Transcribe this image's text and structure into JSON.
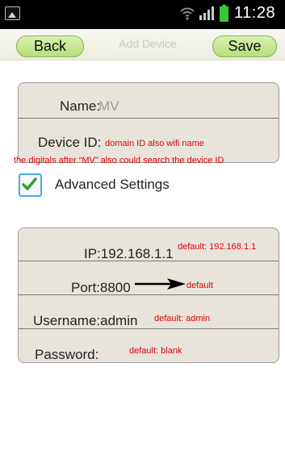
{
  "status_bar": {
    "time": "11:28",
    "icons": [
      "image-notification-icon",
      "wifi-icon",
      "signal-icon",
      "battery-icon"
    ]
  },
  "nav": {
    "back_label": "Back",
    "title": "Add Device",
    "save_label": "Save"
  },
  "form": {
    "name_label": "Name:",
    "name_value": "MV",
    "device_id_label": "Device ID:",
    "device_id_hint": "domain ID also wifi name",
    "device_id_note": "the digitals after  “MV”  also could search the device ID"
  },
  "advanced": {
    "label": "Advanced Settings",
    "checked": true
  },
  "settings": {
    "ip_text": "IP:192.168.1.1",
    "ip_hint": "default: 192.168.1.1",
    "port_text": "Port:8800",
    "port_hint": "default",
    "username_text": "Username:admin",
    "username_hint": "default: admin",
    "password_label": "Password:",
    "password_hint": "default:  blank"
  },
  "colors": {
    "accent_green": "#b4df7a",
    "annotation_red": "#e10000",
    "checkbox_blue": "#52a6e8"
  }
}
